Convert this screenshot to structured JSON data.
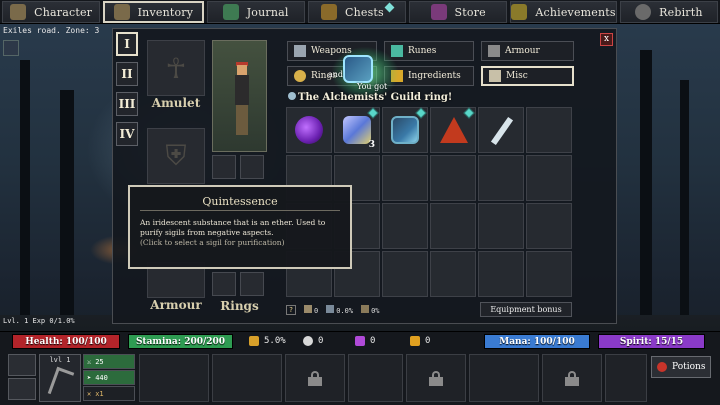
{
  "colors": {
    "health": "#b3242a",
    "stamina": "#2e9c52",
    "mana": "#3a7bd2",
    "spirit": "#8a3ac8",
    "badge": "#59d7c9",
    "glow": "#7dffa8"
  },
  "nav": {
    "items": [
      {
        "label": "Character",
        "icon": "character-icon",
        "color": "#7a6a4a"
      },
      {
        "label": "Inventory",
        "icon": "backpack-icon",
        "color": "#7a6a4a"
      },
      {
        "label": "Journal",
        "icon": "journal-icon",
        "color": "#3e7a52"
      },
      {
        "label": "Chests",
        "icon": "chest-icon",
        "color": "#8a6a2a"
      },
      {
        "label": "Store",
        "icon": "store-icon",
        "color": "#7a3a7a"
      },
      {
        "label": "Achievements",
        "icon": "trophy-icon",
        "color": "#8a7a2a"
      },
      {
        "label": "Rebirth",
        "icon": "moon-icon",
        "color": "#6a6a6a"
      }
    ],
    "active_index": 1
  },
  "zone_text": "Exiles road. Zone: 3",
  "level_text": "Lvl. 1 Exp 0/1.0%",
  "inventory": {
    "vertical_tabs": [
      "I",
      "II",
      "III",
      "IV"
    ],
    "equip_labels": {
      "amulet": "Amulet",
      "armour": "Armour",
      "rings": "Rings"
    },
    "categories": [
      {
        "label": "Weapons",
        "icon": "sword-icon"
      },
      {
        "label": "Runes",
        "icon": "rune-icon"
      },
      {
        "label": "Armour",
        "icon": "armour-icon"
      },
      {
        "label": "Rings",
        "icon": "ring-icon"
      },
      {
        "label": "Ingredients",
        "icon": "herb-icon"
      },
      {
        "label": "Misc",
        "icon": "scroll-icon"
      }
    ],
    "active_category": "Misc",
    "close_label": "x",
    "unlock_text_1": "and",
    "unlock_text_2": "You got",
    "message": "The Alchemists' Guild ring!",
    "items": [
      {
        "name": "purple-orb-icon",
        "color": "#8a3ad0",
        "badge": false
      },
      {
        "name": "quintessence-icon",
        "color": "#5a78d8",
        "badge": true,
        "qty": "3"
      },
      {
        "name": "guild-ring-icon",
        "color": "#3a7aa8",
        "badge": true
      },
      {
        "name": "red-pyramid-icon",
        "color": "#c23a1e",
        "badge": true
      },
      {
        "name": "bone-wand-icon",
        "color": "#d8e4ea",
        "badge": false
      }
    ],
    "stats": {
      "help": "?",
      "defense": "0",
      "dodge": "0.0%",
      "other": "0%"
    },
    "equip_bonus_label": "Equipment bonus"
  },
  "tooltip": {
    "title": "Quintessence",
    "line1": "An iridescent substance that is an ether. Used to",
    "line2": "purify sigils from negative aspects.",
    "hint": "(Click to select a sigil for purification)"
  },
  "status": {
    "health": "Health: 100/100",
    "stamina": "Stamina: 200/200",
    "mana": "Mana: 100/100",
    "spirit": "Spirit: 15/15",
    "resources": [
      {
        "value": "5.0%",
        "icon": "feather-icon",
        "color": "#d8a02a"
      },
      {
        "value": "0",
        "icon": "skull-icon",
        "color": "#d8d8d8"
      },
      {
        "value": "0",
        "icon": "crystal-icon",
        "color": "#b04ad8"
      },
      {
        "value": "0",
        "icon": "gold-icon",
        "color": "#e0a020"
      }
    ],
    "weapon_level": "lvl 1",
    "weapon_stats": [
      "25",
      "440",
      "x1"
    ],
    "potions_label": "Potions"
  }
}
